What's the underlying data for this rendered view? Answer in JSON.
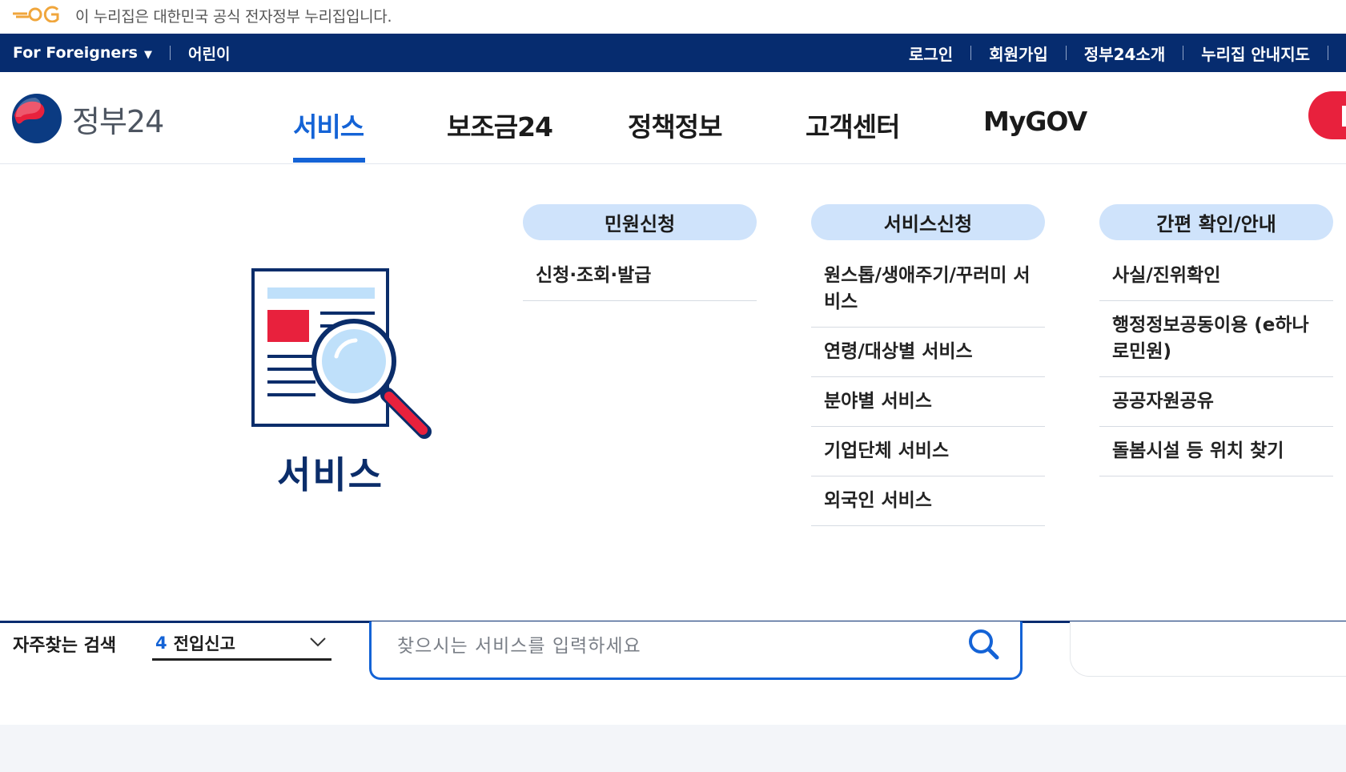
{
  "official_banner": {
    "text": "이 누리집은 대한민국 공식 전자정부 누리집입니다.",
    "logo_icon": "eg-logo-icon",
    "logo_color": "#f0a63c"
  },
  "utility": {
    "foreigners_label": "For Foreigners",
    "kids_label": "어린이",
    "right_links": [
      "로그인",
      "회원가입",
      "정부24소개",
      "누리집 안내지도"
    ]
  },
  "header": {
    "brand_name": "정부24",
    "menu": [
      "서비스",
      "보조금24",
      "정책정보",
      "고객센터",
      "MyGOV"
    ],
    "active_menu": "서비스",
    "accent_color": "#1463d6",
    "navy_color": "#062c6f",
    "cta_color": "#e8213d"
  },
  "mega": {
    "title": "서비스",
    "illustration_icon": "document-search-icon",
    "columns": [
      {
        "heading": "민원신청",
        "items": [
          "신청·조회·발급"
        ]
      },
      {
        "heading": "서비스신청",
        "items": [
          "원스톱/생애주기/꾸러미 서비스",
          "연령/대상별 서비스",
          "분야별 서비스",
          "기업단체 서비스",
          "외국인 서비스"
        ]
      },
      {
        "heading": "간편 확인/안내",
        "items": [
          "사실/진위확인",
          "행정정보공동이용 (e하나로민원)",
          "공공자원공유",
          "돌봄시설 등 위치 찾기"
        ]
      }
    ]
  },
  "search": {
    "frequent_label": "자주찾는 검색",
    "frequent_rank": "4",
    "frequent_term": "전입신고",
    "placeholder": "찾으시는 서비스를 입력하세요"
  }
}
